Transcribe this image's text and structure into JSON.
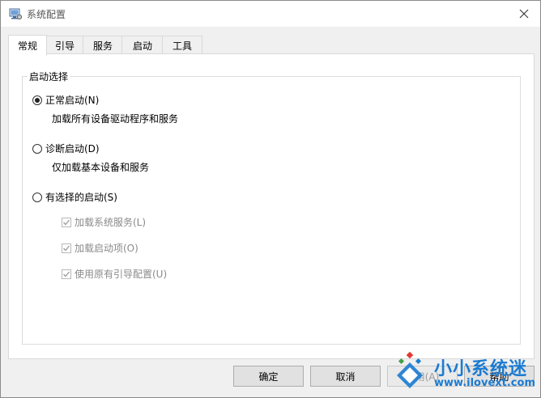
{
  "window": {
    "title": "系统配置"
  },
  "tabs": [
    {
      "label": "常规",
      "active": true
    },
    {
      "label": "引导",
      "active": false
    },
    {
      "label": "服务",
      "active": false
    },
    {
      "label": "启动",
      "active": false
    },
    {
      "label": "工具",
      "active": false
    }
  ],
  "startup": {
    "legend": "启动选择",
    "normal": {
      "label": "正常启动(N)",
      "desc": "加载所有设备驱动程序和服务",
      "selected": true
    },
    "diagnostic": {
      "label": "诊断启动(D)",
      "desc": "仅加载基本设备和服务",
      "selected": false
    },
    "selective": {
      "label": "有选择的启动(S)",
      "selected": false,
      "options": [
        {
          "label": "加载系统服务(L)",
          "checked": true,
          "enabled": false
        },
        {
          "label": "加载启动项(O)",
          "checked": true,
          "enabled": false
        },
        {
          "label": "使用原有引导配置(U)",
          "checked": true,
          "enabled": false
        }
      ]
    }
  },
  "buttons": {
    "ok": "确定",
    "cancel": "取消",
    "apply": "应用(A)",
    "help": "帮助"
  },
  "watermark": {
    "title": "小小系统迷",
    "url": "www.ilovext.com"
  },
  "colors": {
    "accent": "#1b7bd1",
    "disabled_text": "#8a8a8a"
  }
}
